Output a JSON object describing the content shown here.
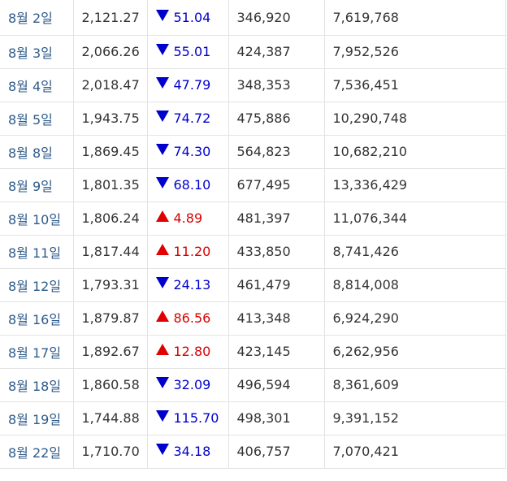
{
  "rows": [
    {
      "date": "8월 2일",
      "close": "2,121.27",
      "direction": "down",
      "change": "51.04",
      "volume": "346,920",
      "amount": "7,619,768"
    },
    {
      "date": "8월 3일",
      "close": "2,066.26",
      "direction": "down",
      "change": "55.01",
      "volume": "424,387",
      "amount": "7,952,526"
    },
    {
      "date": "8월 4일",
      "close": "2,018.47",
      "direction": "down",
      "change": "47.79",
      "volume": "348,353",
      "amount": "7,536,451"
    },
    {
      "date": "8월 5일",
      "close": "1,943.75",
      "direction": "down",
      "change": "74.72",
      "volume": "475,886",
      "amount": "10,290,748"
    },
    {
      "date": "8월 8일",
      "close": "1,869.45",
      "direction": "down",
      "change": "74.30",
      "volume": "564,823",
      "amount": "10,682,210"
    },
    {
      "date": "8월 9일",
      "close": "1,801.35",
      "direction": "down",
      "change": "68.10",
      "volume": "677,495",
      "amount": "13,336,429"
    },
    {
      "date": "8월 10일",
      "close": "1,806.24",
      "direction": "up",
      "change": "4.89",
      "volume": "481,397",
      "amount": "11,076,344"
    },
    {
      "date": "8월 11일",
      "close": "1,817.44",
      "direction": "up",
      "change": "11.20",
      "volume": "433,850",
      "amount": "8,741,426"
    },
    {
      "date": "8월 12일",
      "close": "1,793.31",
      "direction": "down",
      "change": "24.13",
      "volume": "461,479",
      "amount": "8,814,008"
    },
    {
      "date": "8월 16일",
      "close": "1,879.87",
      "direction": "up",
      "change": "86.56",
      "volume": "413,348",
      "amount": "6,924,290"
    },
    {
      "date": "8월 17일",
      "close": "1,892.67",
      "direction": "up",
      "change": "12.80",
      "volume": "423,145",
      "amount": "6,262,956"
    },
    {
      "date": "8월 18일",
      "close": "1,860.58",
      "direction": "down",
      "change": "32.09",
      "volume": "496,594",
      "amount": "8,361,609"
    },
    {
      "date": "8월 19일",
      "close": "1,744.88",
      "direction": "down",
      "change": "115.70",
      "volume": "498,301",
      "amount": "9,391,152"
    },
    {
      "date": "8월 22일",
      "close": "1,710.70",
      "direction": "down",
      "change": "34.18",
      "volume": "406,757",
      "amount": "7,070,421"
    }
  ],
  "colors": {
    "down": "#0000cc",
    "up": "#d80000",
    "date_text": "#2f5b8a",
    "body_text": "#333333",
    "border": "#e3e3e3"
  },
  "icons": {
    "down": "triangle-down-icon",
    "up": "triangle-up-icon"
  }
}
